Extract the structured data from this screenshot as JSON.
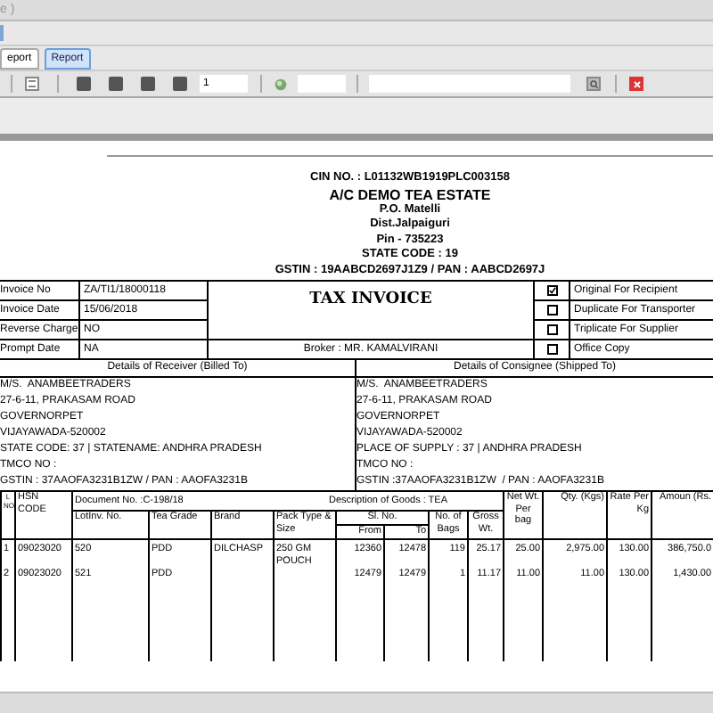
{
  "window": {
    "title": "e )"
  },
  "tabs": [
    {
      "label": "eport",
      "selected": false
    },
    {
      "label": "Report",
      "selected": true
    }
  ],
  "toolbar": {
    "page": "1"
  },
  "header": {
    "cin": "CIN NO. : L01132WB1919PLC003158",
    "company": "A/C DEMO TEA ESTATE",
    "lines": [
      "P.O. Matelli",
      "Dist.Jalpaiguri",
      "Pin - 735223",
      "STATE CODE : 19",
      "GSTIN : 19AABCD2697J1Z9 / PAN : AABCD2697J"
    ]
  },
  "invoice_fields": [
    {
      "label": "Invoice No",
      "value": "ZA/TI1/18000118"
    },
    {
      "label": "Invoice Date",
      "value": "15/06/2018"
    },
    {
      "label": "Reverse Charge",
      "value": "NO"
    },
    {
      "label": "Prompt Date",
      "value": "NA"
    }
  ],
  "title": "TAX INVOICE",
  "broker": "Broker : MR. KAMALVIRANI",
  "copies": [
    {
      "label": "Original For Recipient",
      "checked": true
    },
    {
      "label": "Duplicate For Transporter",
      "checked": false
    },
    {
      "label": "Triplicate For Supplier",
      "checked": false
    },
    {
      "label": "Office Copy",
      "checked": false
    }
  ],
  "receiver": {
    "heading": "Details of Receiver (Billed To)",
    "lines": [
      "M/S.  ANAMBEETRADERS",
      "27-6-11, PRAKASAM ROAD",
      "GOVERNORPET",
      "VIJAYAWADA-520002",
      "STATE CODE: 37 | STATENAME: ANDHRA PRADESH",
      "TMCO NO :",
      "GSTIN : 37AAOFA3231B1ZW / PAN : AAOFA3231B"
    ]
  },
  "consignee": {
    "heading": "Details of Consignee (Shipped To)",
    "lines": [
      "M/S.  ANAMBEETRADERS",
      "27-6-11, PRAKASAM ROAD",
      "GOVERNORPET",
      "VIJAYAWADA-520002",
      "PLACE OF SUPPLY : 37 | ANDHRA PRADESH",
      "TMCO NO :",
      "GSTIN :37AAOFA3231B1ZW  / PAN : AAOFA3231B"
    ]
  },
  "items": {
    "document": "Document No. :C-198/18",
    "description": "Description of Goods : TEA",
    "headers": {
      "sl": "L NO",
      "hsn": "HSN CODE",
      "lot": "LotInv. No.",
      "grade": "Tea Grade",
      "brand": "Brand",
      "pack": "Pack Type & Size",
      "sl_no": "Sl. No.",
      "from": "From",
      "to": "To",
      "bags": "No. of Bags",
      "gross": "Gross Wt.",
      "net": "Net Wt. Per bag",
      "qty": "Qty. (Kgs)",
      "rate": "Rate Per Kg",
      "amount": "Amoun (Rs."
    },
    "rows": [
      {
        "sl": "1",
        "hsn": "09023020",
        "lot": "520",
        "grade": "PDD",
        "brand": "DILCHASP",
        "pack": "250 GM POUCH",
        "from": "12360",
        "to": "12478",
        "bags": "119",
        "gross": "25.17",
        "net": "25.00",
        "qty": "2,975.00",
        "rate": "130.00",
        "amount": "386,750.0"
      },
      {
        "sl": "2",
        "hsn": "09023020",
        "lot": "521",
        "grade": "PDD",
        "brand": "",
        "pack": "",
        "from": "12479",
        "to": "12479",
        "bags": "1",
        "gross": "11.17",
        "net": "11.00",
        "qty": "11.00",
        "rate": "130.00",
        "amount": "1,430.00"
      }
    ]
  }
}
